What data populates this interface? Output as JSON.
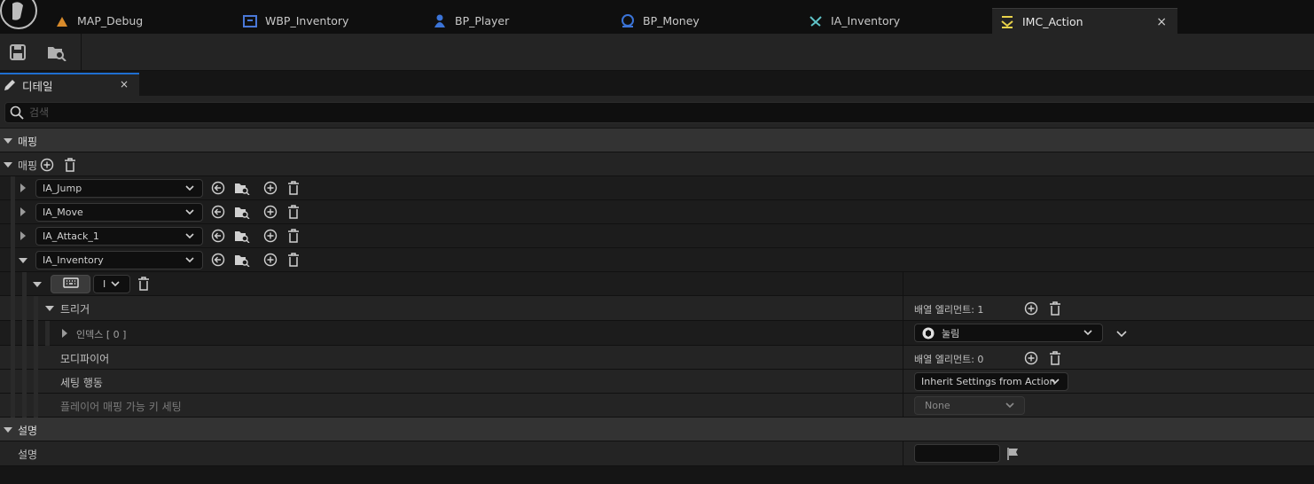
{
  "tabs": [
    {
      "label": "MAP_Debug",
      "icon": "level-map-icon"
    },
    {
      "label": "WBP_Inventory",
      "icon": "widget-blueprint-icon"
    },
    {
      "label": "BP_Player",
      "icon": "character-blueprint-icon"
    },
    {
      "label": "BP_Money",
      "icon": "actor-blueprint-icon"
    },
    {
      "label": "IA_Inventory",
      "icon": "input-action-icon"
    },
    {
      "label": "IMC_Action",
      "icon": "input-mapping-context-icon",
      "close": "×"
    }
  ],
  "toolbar": {
    "buttons": [
      "save-icon",
      "browse-to-asset-icon"
    ]
  },
  "details_panel": {
    "title": "디테일",
    "close": "×"
  },
  "search": {
    "placeholder": "검색"
  },
  "sections": {
    "mapping_category": "매핑",
    "mappings_array_label": "매핑",
    "description_category": "설명"
  },
  "mappings": [
    {
      "action": "IA_Jump"
    },
    {
      "action": "IA_Move"
    },
    {
      "action": "IA_Attack_1"
    },
    {
      "action": "IA_Inventory"
    }
  ],
  "expanded_mapping": {
    "key_value": "I",
    "triggers": {
      "label": "트리거",
      "count_text": "배열 엘리먼트: 1"
    },
    "trigger_index": {
      "label": "인덱스 [ 0 ]",
      "value": "눌림"
    },
    "modifiers": {
      "label": "모디파이어",
      "count_text": "배열 엘리먼트: 0"
    },
    "setting_behavior": {
      "label": "세팅 행동",
      "value": "Inherit Settings from Action"
    },
    "player_mappable": {
      "label": "플레이어 매핑 가능 키 세팅",
      "value": "None"
    }
  },
  "description": {
    "label": "설명",
    "value": ""
  },
  "colors": {
    "accent": "#1f6fd0",
    "panel": "#242424",
    "category": "#333333",
    "background": "#151515"
  }
}
